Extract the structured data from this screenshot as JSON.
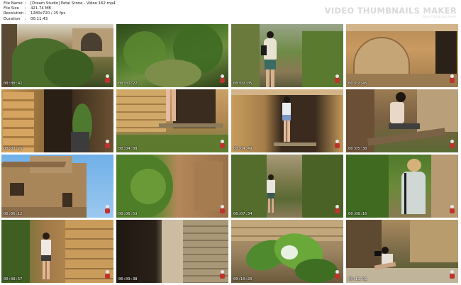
{
  "header": {
    "info": [
      {
        "key": "File Name",
        "value": "[Dream Studio] Petal Stone - Video 162.mp4"
      },
      {
        "key": "File Size",
        "value": "421.74 MB"
      },
      {
        "key": "Resolution",
        "value": "1280x720 / 25 fps"
      },
      {
        "key": "Duration",
        "value": "00:11:43"
      }
    ],
    "separator": ":",
    "brand_name": "VIDEO THUMBNAILS MAKER",
    "brand_sub": "Video Thumbnails Maker"
  },
  "thumbnails": [
    {
      "time": "00:00:41",
      "scene": "ruin-garden"
    },
    {
      "time": "00:01:22",
      "scene": "dense-foliage"
    },
    {
      "time": "00:02:05",
      "scene": "girl-backpack"
    },
    {
      "time": "00:02:45",
      "scene": "arched-room"
    },
    {
      "time": "00:03:26",
      "scene": "column-doorway"
    },
    {
      "time": "00:04:08",
      "scene": "stone-wall-legs"
    },
    {
      "time": "00:04:49",
      "scene": "girl-doorway"
    },
    {
      "time": "00:05:30",
      "scene": "girl-sitting"
    },
    {
      "time": "00:06:12",
      "scene": "building-sky"
    },
    {
      "time": "00:06:53",
      "scene": "leafy-wall"
    },
    {
      "time": "00:07:34",
      "scene": "girl-walking"
    },
    {
      "time": "00:08:16",
      "scene": "girl-blonde"
    },
    {
      "time": "00:08:57",
      "scene": "girl-stone"
    },
    {
      "time": "00:09:38",
      "scene": "dark-wall"
    },
    {
      "time": "00:10:20",
      "scene": "leaves-closeup"
    },
    {
      "time": "00:11:01",
      "scene": "girl-camera"
    }
  ]
}
